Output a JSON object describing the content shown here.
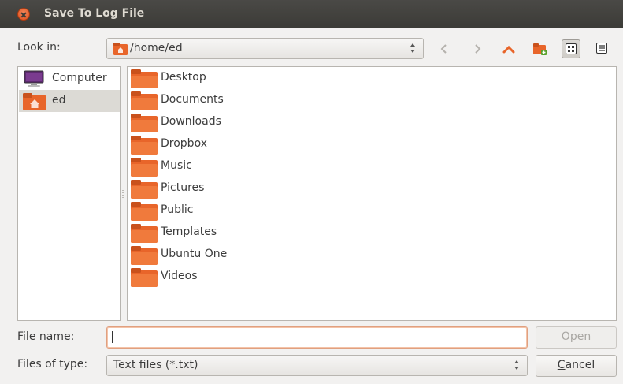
{
  "window": {
    "title": "Save To Log File"
  },
  "toolbar": {
    "look_in_label": "Look in:",
    "path": "/home/ed"
  },
  "sidebar": {
    "items": [
      {
        "label": "Computer",
        "icon": "computer-icon"
      },
      {
        "label": "ed",
        "icon": "home-folder-icon",
        "selected": true
      }
    ]
  },
  "files": {
    "items": [
      {
        "label": "Desktop"
      },
      {
        "label": "Documents"
      },
      {
        "label": "Downloads"
      },
      {
        "label": "Dropbox"
      },
      {
        "label": "Music"
      },
      {
        "label": "Pictures"
      },
      {
        "label": "Public"
      },
      {
        "label": "Templates"
      },
      {
        "label": "Ubuntu One"
      },
      {
        "label": "Videos"
      }
    ]
  },
  "form": {
    "file_name_label_pre": "File ",
    "file_name_label_mnemonic": "n",
    "file_name_label_post": "ame:",
    "file_name_value": "",
    "files_of_type_label": "Files of type:",
    "files_of_type_value": "Text files (*.txt)"
  },
  "buttons": {
    "open_mnemonic": "O",
    "open_rest": "pen",
    "cancel_mnemonic": "C",
    "cancel_rest": "ancel"
  },
  "colors": {
    "folder_orange": "#e8652a",
    "close_red": "#df4a16",
    "selected_bg": "#dcdad5"
  }
}
